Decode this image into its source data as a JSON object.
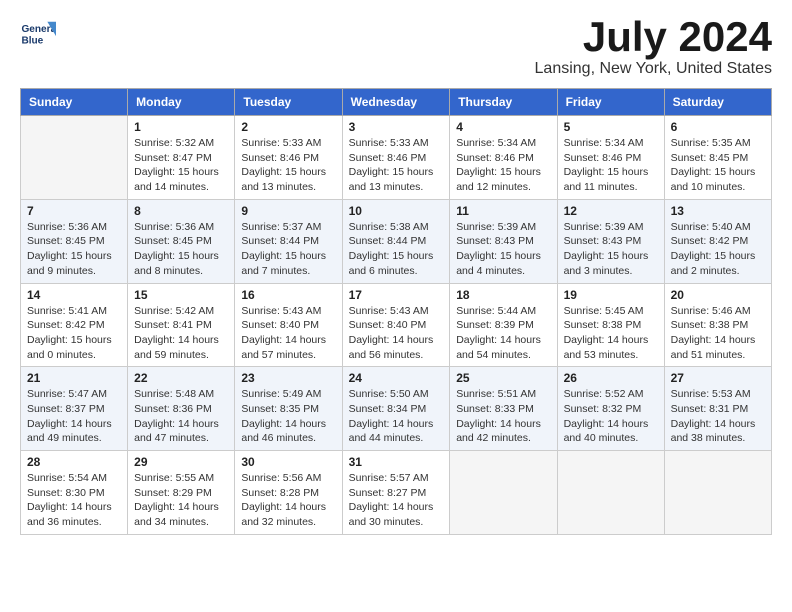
{
  "header": {
    "logo_line1": "General",
    "logo_line2": "Blue",
    "month_title": "July 2024",
    "location": "Lansing, New York, United States"
  },
  "weekdays": [
    "Sunday",
    "Monday",
    "Tuesday",
    "Wednesday",
    "Thursday",
    "Friday",
    "Saturday"
  ],
  "weeks": [
    [
      {
        "day": "",
        "lines": []
      },
      {
        "day": "1",
        "lines": [
          "Sunrise: 5:32 AM",
          "Sunset: 8:47 PM",
          "Daylight: 15 hours",
          "and 14 minutes."
        ]
      },
      {
        "day": "2",
        "lines": [
          "Sunrise: 5:33 AM",
          "Sunset: 8:46 PM",
          "Daylight: 15 hours",
          "and 13 minutes."
        ]
      },
      {
        "day": "3",
        "lines": [
          "Sunrise: 5:33 AM",
          "Sunset: 8:46 PM",
          "Daylight: 15 hours",
          "and 13 minutes."
        ]
      },
      {
        "day": "4",
        "lines": [
          "Sunrise: 5:34 AM",
          "Sunset: 8:46 PM",
          "Daylight: 15 hours",
          "and 12 minutes."
        ]
      },
      {
        "day": "5",
        "lines": [
          "Sunrise: 5:34 AM",
          "Sunset: 8:46 PM",
          "Daylight: 15 hours",
          "and 11 minutes."
        ]
      },
      {
        "day": "6",
        "lines": [
          "Sunrise: 5:35 AM",
          "Sunset: 8:45 PM",
          "Daylight: 15 hours",
          "and 10 minutes."
        ]
      }
    ],
    [
      {
        "day": "7",
        "lines": [
          "Sunrise: 5:36 AM",
          "Sunset: 8:45 PM",
          "Daylight: 15 hours",
          "and 9 minutes."
        ]
      },
      {
        "day": "8",
        "lines": [
          "Sunrise: 5:36 AM",
          "Sunset: 8:45 PM",
          "Daylight: 15 hours",
          "and 8 minutes."
        ]
      },
      {
        "day": "9",
        "lines": [
          "Sunrise: 5:37 AM",
          "Sunset: 8:44 PM",
          "Daylight: 15 hours",
          "and 7 minutes."
        ]
      },
      {
        "day": "10",
        "lines": [
          "Sunrise: 5:38 AM",
          "Sunset: 8:44 PM",
          "Daylight: 15 hours",
          "and 6 minutes."
        ]
      },
      {
        "day": "11",
        "lines": [
          "Sunrise: 5:39 AM",
          "Sunset: 8:43 PM",
          "Daylight: 15 hours",
          "and 4 minutes."
        ]
      },
      {
        "day": "12",
        "lines": [
          "Sunrise: 5:39 AM",
          "Sunset: 8:43 PM",
          "Daylight: 15 hours",
          "and 3 minutes."
        ]
      },
      {
        "day": "13",
        "lines": [
          "Sunrise: 5:40 AM",
          "Sunset: 8:42 PM",
          "Daylight: 15 hours",
          "and 2 minutes."
        ]
      }
    ],
    [
      {
        "day": "14",
        "lines": [
          "Sunrise: 5:41 AM",
          "Sunset: 8:42 PM",
          "Daylight: 15 hours",
          "and 0 minutes."
        ]
      },
      {
        "day": "15",
        "lines": [
          "Sunrise: 5:42 AM",
          "Sunset: 8:41 PM",
          "Daylight: 14 hours",
          "and 59 minutes."
        ]
      },
      {
        "day": "16",
        "lines": [
          "Sunrise: 5:43 AM",
          "Sunset: 8:40 PM",
          "Daylight: 14 hours",
          "and 57 minutes."
        ]
      },
      {
        "day": "17",
        "lines": [
          "Sunrise: 5:43 AM",
          "Sunset: 8:40 PM",
          "Daylight: 14 hours",
          "and 56 minutes."
        ]
      },
      {
        "day": "18",
        "lines": [
          "Sunrise: 5:44 AM",
          "Sunset: 8:39 PM",
          "Daylight: 14 hours",
          "and 54 minutes."
        ]
      },
      {
        "day": "19",
        "lines": [
          "Sunrise: 5:45 AM",
          "Sunset: 8:38 PM",
          "Daylight: 14 hours",
          "and 53 minutes."
        ]
      },
      {
        "day": "20",
        "lines": [
          "Sunrise: 5:46 AM",
          "Sunset: 8:38 PM",
          "Daylight: 14 hours",
          "and 51 minutes."
        ]
      }
    ],
    [
      {
        "day": "21",
        "lines": [
          "Sunrise: 5:47 AM",
          "Sunset: 8:37 PM",
          "Daylight: 14 hours",
          "and 49 minutes."
        ]
      },
      {
        "day": "22",
        "lines": [
          "Sunrise: 5:48 AM",
          "Sunset: 8:36 PM",
          "Daylight: 14 hours",
          "and 47 minutes."
        ]
      },
      {
        "day": "23",
        "lines": [
          "Sunrise: 5:49 AM",
          "Sunset: 8:35 PM",
          "Daylight: 14 hours",
          "and 46 minutes."
        ]
      },
      {
        "day": "24",
        "lines": [
          "Sunrise: 5:50 AM",
          "Sunset: 8:34 PM",
          "Daylight: 14 hours",
          "and 44 minutes."
        ]
      },
      {
        "day": "25",
        "lines": [
          "Sunrise: 5:51 AM",
          "Sunset: 8:33 PM",
          "Daylight: 14 hours",
          "and 42 minutes."
        ]
      },
      {
        "day": "26",
        "lines": [
          "Sunrise: 5:52 AM",
          "Sunset: 8:32 PM",
          "Daylight: 14 hours",
          "and 40 minutes."
        ]
      },
      {
        "day": "27",
        "lines": [
          "Sunrise: 5:53 AM",
          "Sunset: 8:31 PM",
          "Daylight: 14 hours",
          "and 38 minutes."
        ]
      }
    ],
    [
      {
        "day": "28",
        "lines": [
          "Sunrise: 5:54 AM",
          "Sunset: 8:30 PM",
          "Daylight: 14 hours",
          "and 36 minutes."
        ]
      },
      {
        "day": "29",
        "lines": [
          "Sunrise: 5:55 AM",
          "Sunset: 8:29 PM",
          "Daylight: 14 hours",
          "and 34 minutes."
        ]
      },
      {
        "day": "30",
        "lines": [
          "Sunrise: 5:56 AM",
          "Sunset: 8:28 PM",
          "Daylight: 14 hours",
          "and 32 minutes."
        ]
      },
      {
        "day": "31",
        "lines": [
          "Sunrise: 5:57 AM",
          "Sunset: 8:27 PM",
          "Daylight: 14 hours",
          "and 30 minutes."
        ]
      },
      {
        "day": "",
        "lines": []
      },
      {
        "day": "",
        "lines": []
      },
      {
        "day": "",
        "lines": []
      }
    ]
  ]
}
